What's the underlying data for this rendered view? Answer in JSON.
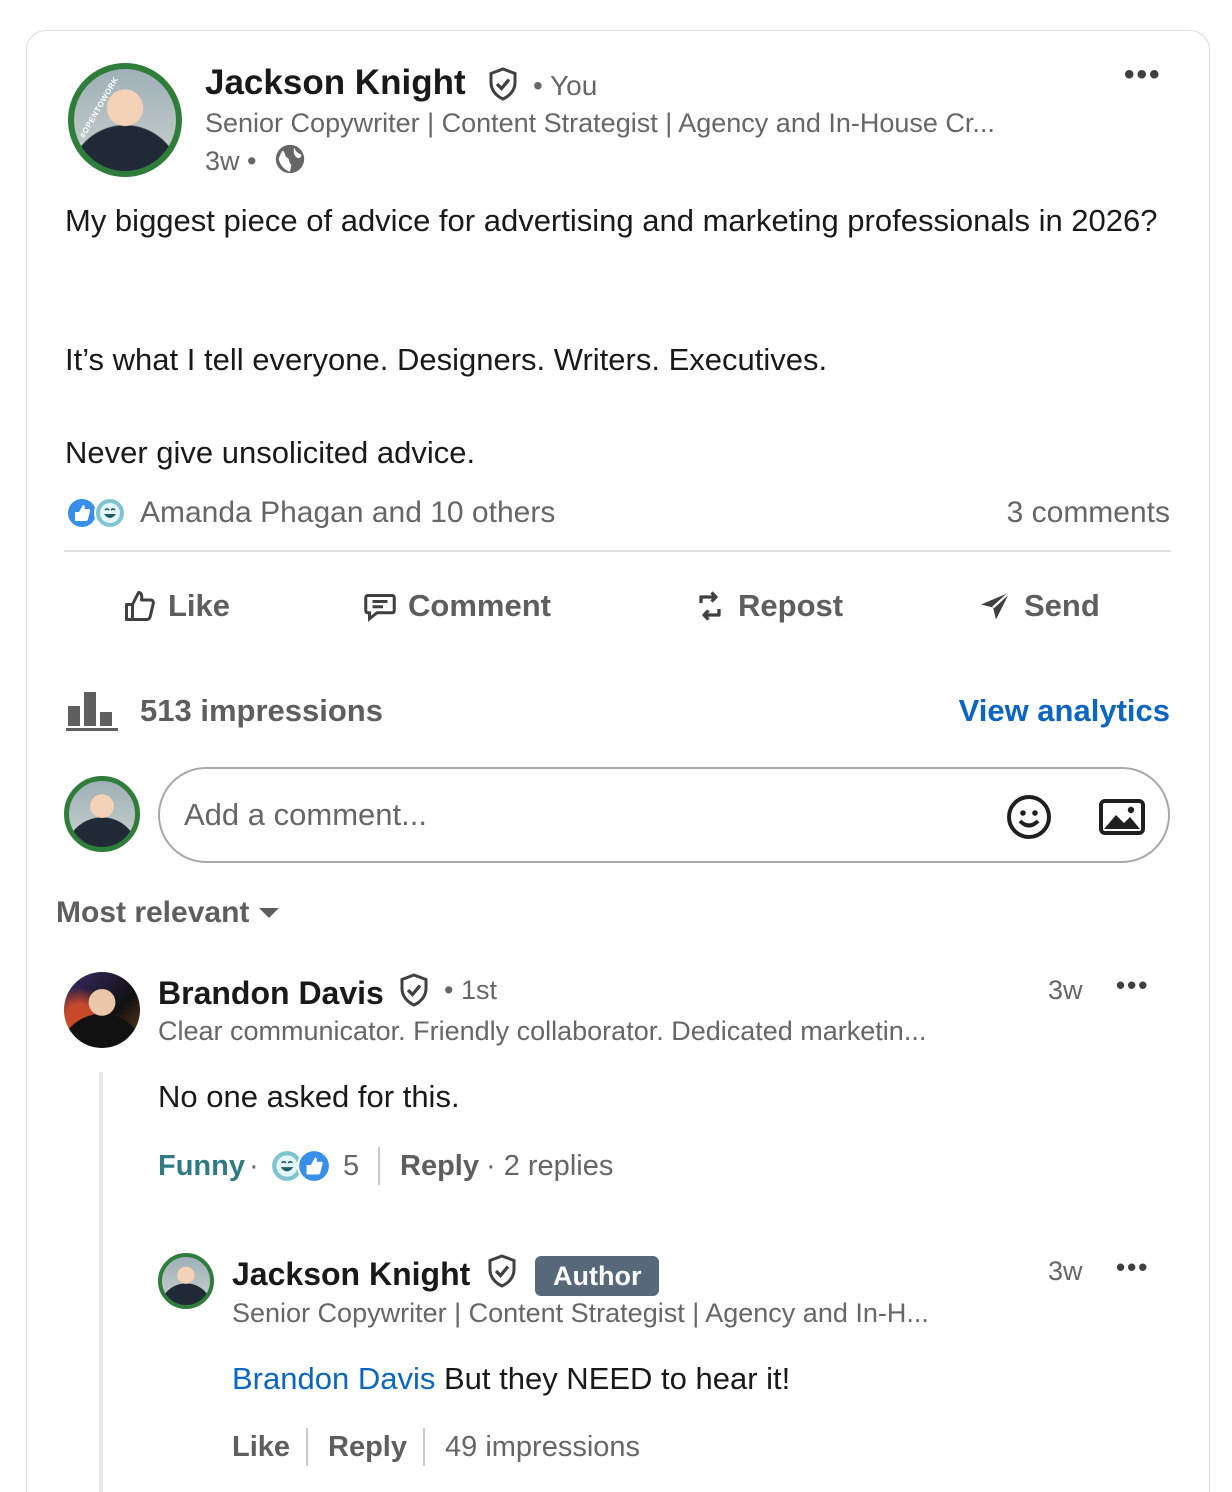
{
  "post": {
    "author_name": "Jackson Knight",
    "relation": "• You",
    "headline": "Senior Copywriter | Content Strategist | Agency and In-House Cr...",
    "age": "3w •",
    "body": [
      "My biggest piece of advice for advertising and marketing professionals in 2026?",
      "It’s what I tell everyone. Designers. Writers. Executives.",
      "Never give unsolicited advice."
    ],
    "reactions_text": "Amanda Phagan and 10 others",
    "comments_count": "3 comments",
    "open_to_work": "#OPENTOWORK"
  },
  "actions": {
    "like": "Like",
    "comment": "Comment",
    "repost": "Repost",
    "send": "Send"
  },
  "analytics": {
    "impressions": "513 impressions",
    "view_link": "View analytics"
  },
  "comment_input": {
    "placeholder": "Add a comment..."
  },
  "sort": {
    "label": "Most relevant"
  },
  "comments": [
    {
      "author_name": "Brandon Davis",
      "relation": "• 1st",
      "headline": "Clear communicator. Friendly collaborator. Dedicated marketin...",
      "age": "3w",
      "text": "No one asked for this.",
      "reaction_label": "Funny",
      "dot": "·",
      "reaction_count": "5",
      "reply_label": "Reply",
      "replies": "· 2 replies"
    }
  ],
  "reply": {
    "author_name": "Jackson Knight",
    "badge": "Author",
    "headline": "Senior Copywriter | Content Strategist | Agency and In-H...",
    "age": "3w",
    "mention": "Brandon Davis",
    "text": " But they NEED to hear it!",
    "like_label": "Like",
    "reply_label": "Reply",
    "impressions": "49 impressions"
  },
  "colors": {
    "accent_blue": "#0a66c2",
    "open_to_work_green": "#2f7d3a",
    "funny_teal": "#2f7a85",
    "author_badge": "#56687a"
  }
}
